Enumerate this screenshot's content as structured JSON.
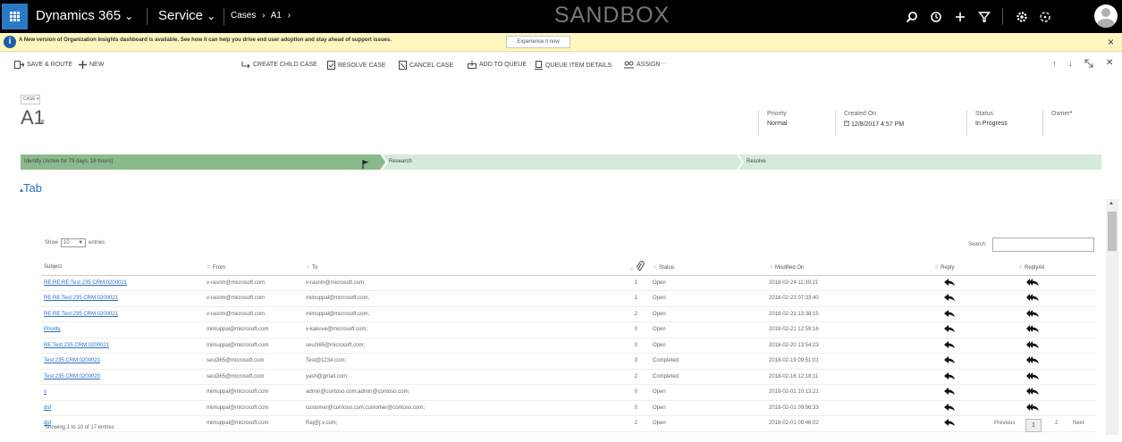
{
  "topbar": {
    "app_name": "Dynamics 365",
    "app_chevron": "⌄",
    "area": "Service",
    "area_chevron": "⌄",
    "crumb_entity": "Cases",
    "crumb_sep": "›",
    "crumb_record": "A1",
    "crumb_sep2": "›",
    "environment": "SANDBOX"
  },
  "notification": {
    "message": "A New version of Organization Insights dashboard is available. See how it can help you drive end user adoption and stay ahead of support issues.",
    "button": "Experience it now",
    "close": "×",
    "info_glyph": "i"
  },
  "commands": {
    "save_route": "SAVE & ROUTE",
    "new": "NEW",
    "create_child": "CREATE CHILD CASE",
    "resolve": "RESOLVE CASE",
    "cancel": "CANCEL CASE",
    "add_queue": "ADD TO QUEUE",
    "queue_details": "QUEUE ITEM DETAILS",
    "assign": "ASSIGN",
    "more": "···",
    "up": "↑",
    "down": "↓",
    "close": "✕"
  },
  "record": {
    "type": "CASE ▾",
    "name": "A1",
    "menu_glyph": "▾≡",
    "priority_label": "Priority",
    "priority_value": "Normal",
    "created_label": "Created On",
    "created_value": "12/8/2017  4:57 PM",
    "status_label": "Status",
    "status_value": "In Progress",
    "owner_label": "Owner",
    "owner_req": "*"
  },
  "process": {
    "stage1": "Identify (Active for 79 days, 18 hours)",
    "stage2": "Research",
    "stage3": "Resolve"
  },
  "tab": {
    "title": "Tab",
    "collapse": "▴"
  },
  "grid": {
    "show_prefix": "Show",
    "show_value": "10",
    "show_suffix": "entries",
    "search_label": "Search:",
    "columns": {
      "subject": "Subject",
      "from": "From",
      "to": "To",
      "status": "Status",
      "modified": "Modified On",
      "reply": "Reply",
      "replyall": "ReplyAll"
    },
    "rows": [
      {
        "subject": "RE:RE:RE:Test 235 CRM:0200021",
        "from": "v-rasrim@microsoft.com",
        "to": "v-rasrim@microsoft.com;",
        "att": "1",
        "status": "Open",
        "modified": "2018-02-24 11:39:21"
      },
      {
        "subject": "RE:RE:Test 235 CRM:0200021",
        "from": "v-rasrim@microsoft.com",
        "to": "mimuppal@microsoft.com;",
        "att": "1",
        "status": "Open",
        "modified": "2018-02-23 07:33:40"
      },
      {
        "subject": "RE:RE:Test 235 CRM:0200021",
        "from": "v-rasrim@microsoft.com",
        "to": "mimuppal@microsoft.com;",
        "att": "2",
        "status": "Open",
        "modified": "2018-02-21 13:38:15"
      },
      {
        "subject": "Priority",
        "from": "mimuppal@microsoft.com",
        "to": "v-kakuve@microsoft.com;",
        "att": "0",
        "status": "Open",
        "modified": "2018-02-21 12:59:16"
      },
      {
        "subject": "RE:Test 235 CRM:0200021",
        "from": "mimuppal@microsoft.com",
        "to": "seui365@microsoft.com;",
        "att": "0",
        "status": "Open",
        "modified": "2018-02-20 13:54:23"
      },
      {
        "subject": "Test 235 CRM:0200021",
        "from": "seui365@microsoft.com",
        "to": "Test@1234.com;",
        "att": "3",
        "status": "Completed",
        "modified": "2018-02-19 09:51:01"
      },
      {
        "subject": "Test 235 CRM:0200020",
        "from": "seui365@microsoft.com",
        "to": "yash@gmail.com;",
        "att": "2",
        "status": "Completed",
        "modified": "2018-02-16 12:18:11"
      },
      {
        "subject": "s",
        "from": "mimuppal@microsoft.com",
        "to": "admin@contoso.com;admin@contoso.com;",
        "att": "0",
        "status": "Open",
        "modified": "2018-02-01 10:13:21"
      },
      {
        "subject": "dsf",
        "from": "mimuppal@microsoft.com",
        "to": "customer@contoso.com;customer@contoso.com;",
        "att": "0",
        "status": "Open",
        "modified": "2018-02-01 09:56:33"
      },
      {
        "subject": "dsf",
        "from": "mimuppal@microsoft.com",
        "to": "Raj@j.v.com;",
        "att": "2",
        "status": "Open",
        "modified": "2018-02-01 09:46:02"
      }
    ],
    "footer": "Showing 1 to 10 of 17 entries",
    "previous": "Previous",
    "page1": "1",
    "page2": "2",
    "next": "Next"
  }
}
